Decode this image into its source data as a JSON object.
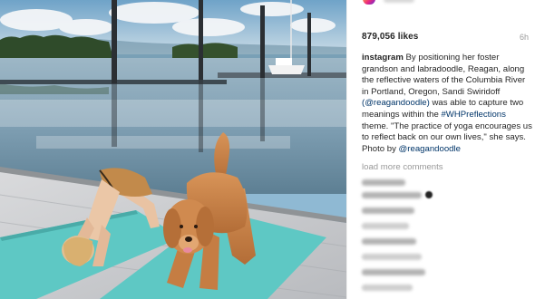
{
  "post": {
    "likes": "879,056 likes",
    "time_ago": "6h",
    "caption": {
      "username": "instagram",
      "text_1": " By positioning her foster grandson and labradoodle, Reagan, along the reflective waters of the Columbia River in Portland, Oregon, Sandi Swiridoff ",
      "mention_1": "(@reagandoodle)",
      "text_2": " was able to capture two meanings within the ",
      "hashtag": "#WHPreflections",
      "text_3": " theme. \"The practice of yoga encourages us to reflect back on our own lives,\" she says.",
      "photo_by": "Photo by ",
      "mention_2": "@reagandoodle"
    },
    "load_more": "load more comments"
  },
  "colors": {
    "link": "#003569",
    "muted": "#999999",
    "text": "#262626",
    "mat": "#5ec8c4",
    "dog": "#c9834a",
    "water": "#6f93a8"
  },
  "icons": {
    "avatar": "instagram-avatar-icon",
    "heart": "heart-icon"
  }
}
